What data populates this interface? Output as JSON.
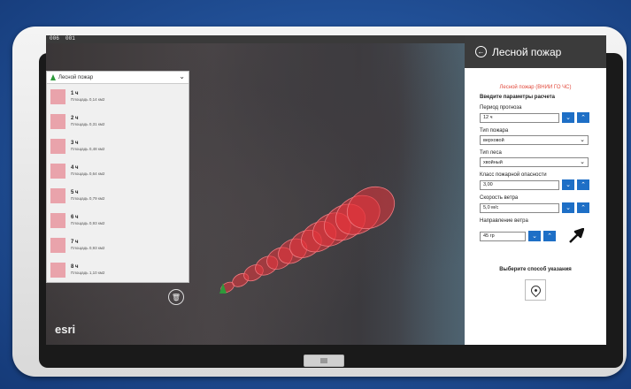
{
  "topbar": {
    "left": "006",
    "right": "001"
  },
  "layers": {
    "title": "Лесной пожар",
    "items": [
      {
        "title": "1 ч",
        "area": "Площадь 0,14 км2"
      },
      {
        "title": "2 ч",
        "area": "Площадь 0,31 км2"
      },
      {
        "title": "3 ч",
        "area": "Площадь 0,48 км2"
      },
      {
        "title": "4 ч",
        "area": "Площадь 0,64 км2"
      },
      {
        "title": "5 ч",
        "area": "Площадь 0,79 км2"
      },
      {
        "title": "6 ч",
        "area": "Площадь 0,93 км2"
      },
      {
        "title": "7 ч",
        "area": "Площадь 0,93 км2"
      },
      {
        "title": "8 ч",
        "area": "Площадь 1,10 км2"
      }
    ]
  },
  "map": {
    "attribution": "esri",
    "fire_color": "#e8343c"
  },
  "panel": {
    "header": "Лесной пожар",
    "subtitle": "Лесной пожар (ВНИИ ГО ЧС)",
    "section_title": "Введите параметры расчета",
    "forecast_label": "Период прогноза",
    "forecast_value": "12 ч",
    "fire_type_label": "Тип пожара",
    "fire_type_value": "верховой",
    "forest_type_label": "Тип леса",
    "forest_type_value": "хвойный",
    "danger_label": "Класс пожарной опасности",
    "danger_value": "3,00",
    "wind_speed_label": "Скорость ветра",
    "wind_speed_value": "5,0 м/с",
    "wind_dir_label": "Направление ветра",
    "wind_dir_value": "45 гр",
    "method_title": "Выберите способ указания"
  },
  "colors": {
    "accent": "#1e6fc6",
    "header": "#3b3b3b",
    "subtitle": "#e24a3c"
  }
}
